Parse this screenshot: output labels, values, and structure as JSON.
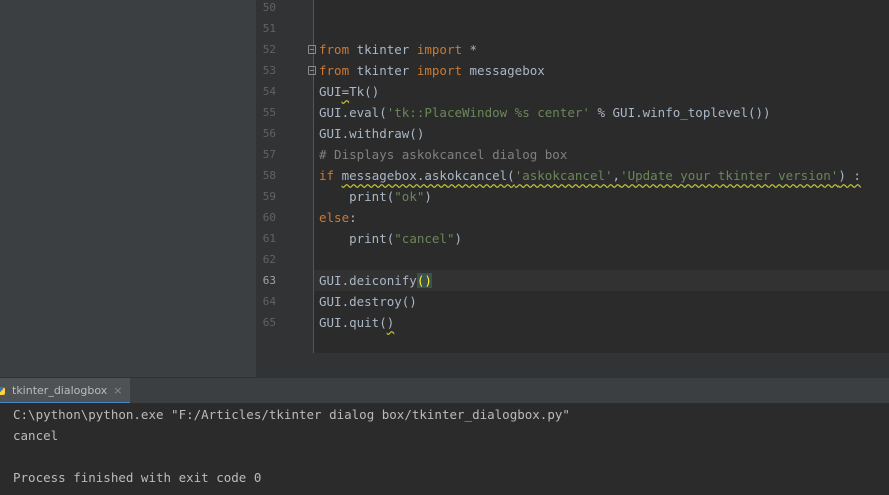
{
  "editor": {
    "line_numbers": [
      "50",
      "51",
      "52",
      "53",
      "54",
      "55",
      "56",
      "57",
      "58",
      "59",
      "60",
      "61",
      "62",
      "63",
      "64",
      "65"
    ],
    "current_line": "63",
    "code": {
      "l52": {
        "kw1": "from",
        "mod": " tkinter ",
        "kw2": "import",
        "rest": " *"
      },
      "l53": {
        "kw1": "from",
        "mod": " tkinter ",
        "kw2": "import",
        "rest": " messagebox"
      },
      "l54": {
        "a": "GUI",
        "b": "=",
        "c": "Tk",
        "d": "()"
      },
      "l55": {
        "a": "GUI.eval(",
        "s": "'tk::PlaceWindow %s center'",
        "b": " % GUI.winfo_toplevel())"
      },
      "l56": "GUI.withdraw()",
      "l57": "# Displays askokcancel dialog box",
      "l58": {
        "kw": "if",
        "a": " ",
        "call": "messagebox.askokcancel(",
        "s1": "'askokcancel'",
        "comma": ",",
        "s2": "'Update your tkinter version'",
        "tail": ") :"
      },
      "l59": {
        "indent": "    ",
        "a": "print(",
        "s": "\"ok\"",
        "b": ")"
      },
      "l60": {
        "kw": "else",
        "b": ":"
      },
      "l61": {
        "indent": "    ",
        "a": "print(",
        "s": "\"cancel\"",
        "b": ")"
      },
      "l63": {
        "a": "GUI.deiconify",
        "paren": "()"
      },
      "l64": "GUI.destroy()",
      "l65": {
        "a": "GUI.quit(",
        "b": ")"
      }
    }
  },
  "run_panel": {
    "tab_label": "tkinter_dialogbox",
    "close_glyph": "×",
    "icon": "python-icon",
    "output": [
      "C:\\python\\python.exe \"F:/Articles/tkinter dialog box/tkinter_dialogbox.py\"",
      "cancel",
      "",
      "Process finished with exit code 0"
    ]
  },
  "colors": {
    "keyword": "#cc7832",
    "string": "#6a8759",
    "comment": "#808080",
    "text": "#a9b7c6",
    "background": "#2b2b2b"
  }
}
